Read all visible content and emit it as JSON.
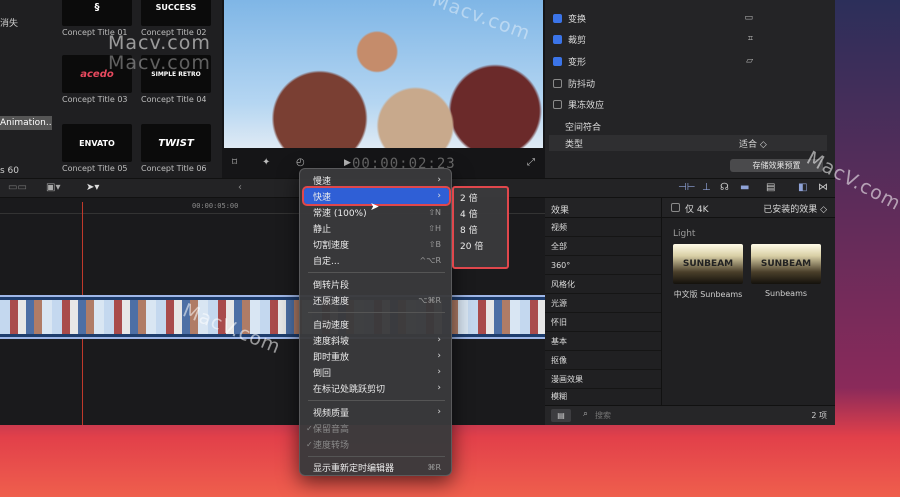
{
  "browser": {
    "sidebar": [
      {
        "label": "消失"
      },
      {
        "label": "Animation..."
      },
      {
        "label": "s 60"
      }
    ],
    "thumbnails": [
      {
        "label": "Concept Title 01",
        "art": "§"
      },
      {
        "label": "Concept Title 02",
        "art": "SUCCESS"
      },
      {
        "label": "Concept Title 03",
        "art": "acedo"
      },
      {
        "label": "Concept Title 04",
        "art": "SIMPLE RETRO"
      },
      {
        "label": "Concept Title 05",
        "art": "ENVATO"
      },
      {
        "label": "Concept Title 06",
        "art": "TWIST"
      }
    ]
  },
  "viewer": {
    "timecode": "00:00:02:23"
  },
  "inspector": {
    "rows": [
      {
        "label": "变换",
        "checked": true,
        "icon": "▭"
      },
      {
        "label": "裁剪",
        "checked": true,
        "icon": "⌗"
      },
      {
        "label": "变形",
        "checked": true,
        "icon": "▱"
      },
      {
        "label": "防抖动",
        "checked": false,
        "icon": ""
      },
      {
        "label": "果冻效应",
        "checked": false,
        "icon": ""
      }
    ],
    "section": "空间符合",
    "type_label": "类型",
    "type_value": "适合 ◇",
    "save_preset": "存储效果预置"
  },
  "timeline": {
    "ruler_time": "00:00:05:00"
  },
  "effects": {
    "header_left": "效果",
    "only4k": "仅 4K",
    "installed": "已安装的效果 ◇",
    "categories": [
      "视频",
      "全部",
      "360°",
      "风格化",
      "光源",
      "怀旧",
      "基本",
      "抠像",
      "漫画效果",
      "模糊"
    ],
    "group": "Light",
    "tiles": [
      {
        "label": "中文版 Sunbeams",
        "art": "SUNBEAM"
      },
      {
        "label": "Sunbeams",
        "art": "SUNBEAM"
      }
    ],
    "search_placeholder": "搜索",
    "count": "2 项"
  },
  "menu": {
    "items": [
      {
        "label": "慢速",
        "arrow": "›"
      },
      {
        "label": "快速",
        "arrow": "›",
        "highlight": true
      },
      {
        "label": "常速 (100%)",
        "shortcut": "⇧N"
      },
      {
        "label": "静止",
        "shortcut": "⇧H"
      },
      {
        "label": "切割速度",
        "shortcut": "⇧B"
      },
      {
        "label": "自定...",
        "shortcut": "^⌥R"
      },
      {
        "label": "倒转片段"
      },
      {
        "label": "还原速度",
        "shortcut": "⌥⌘R"
      },
      {
        "label": "自动速度"
      },
      {
        "label": "速度斜坡",
        "arrow": "›"
      },
      {
        "label": "即时重放",
        "arrow": "›"
      },
      {
        "label": "倒回",
        "arrow": "›"
      },
      {
        "label": "在标记处跳跃剪切",
        "arrow": "›"
      },
      {
        "label": "视频质量",
        "arrow": "›"
      },
      {
        "label": "保留音高",
        "disabled": true,
        "check": "✓"
      },
      {
        "label": "速度转场",
        "disabled": true,
        "check": "✓"
      },
      {
        "label": "显示重新定时编辑器",
        "shortcut": "⌘R"
      }
    ]
  },
  "submenu": {
    "items": [
      "2 倍",
      "4 倍",
      "8 倍",
      "20 倍"
    ]
  },
  "watermarks": [
    "Macv.com",
    "Macv.com",
    "MacV.com",
    "MacV.com",
    "Macv.com"
  ]
}
